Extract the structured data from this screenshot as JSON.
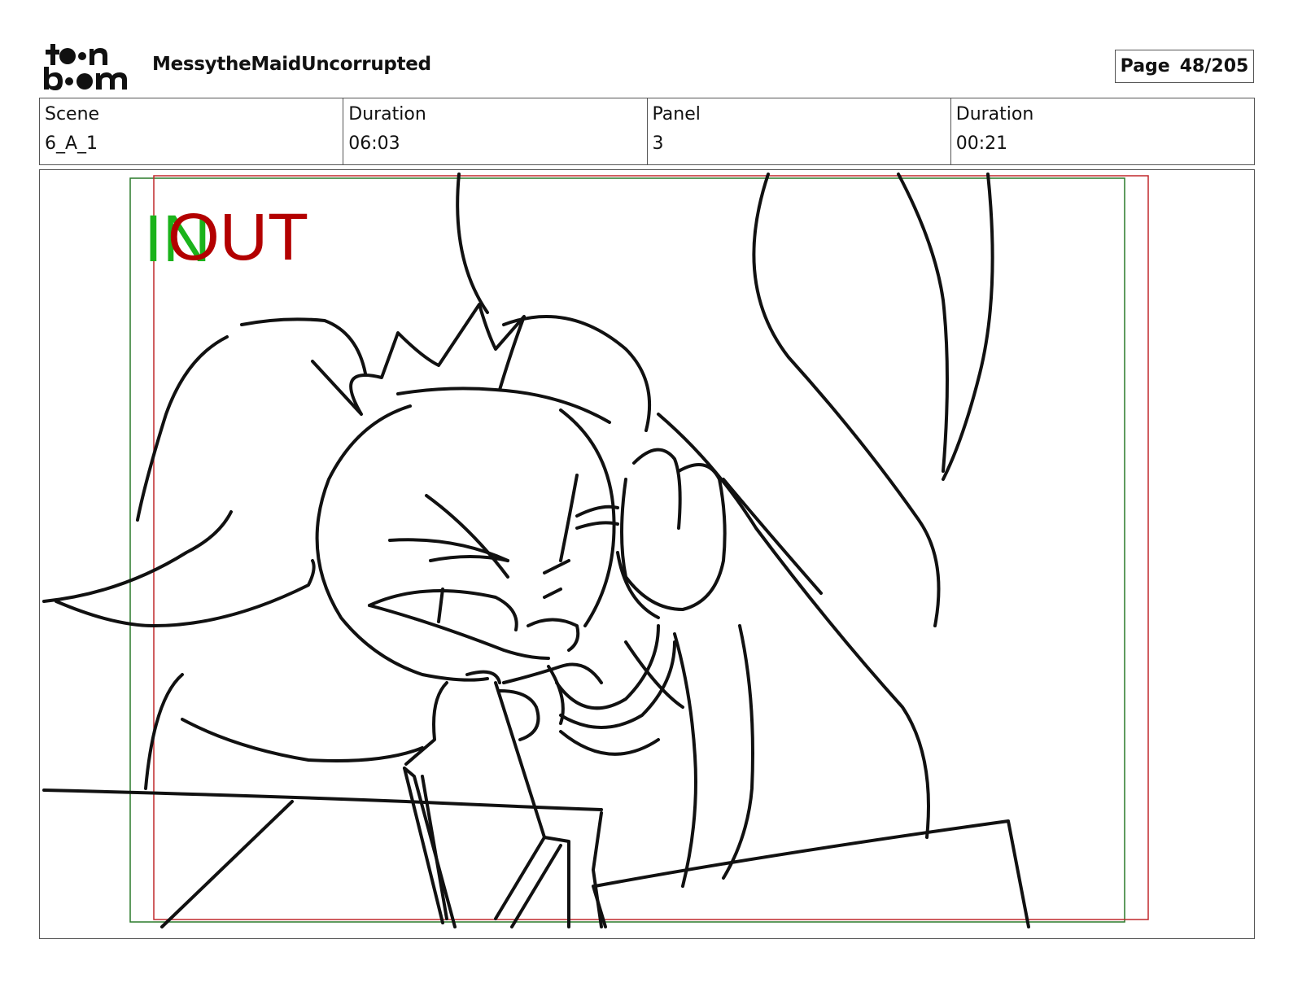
{
  "header": {
    "logo_lines": [
      "toon",
      "boom"
    ],
    "project_title": "MessytheMaidUncorrupted",
    "page_label": "Page",
    "page_number": "48/205"
  },
  "info_table": [
    {
      "label": "Scene",
      "value": "6_A_1"
    },
    {
      "label": "Duration",
      "value": "06:03"
    },
    {
      "label": "Panel",
      "value": "3"
    },
    {
      "label": "Duration",
      "value": "00:21"
    }
  ],
  "panel": {
    "in_marker": "IN",
    "out_marker": "OUT",
    "colors": {
      "in": "#1bb31b",
      "out": "#b30000",
      "frame_green": "#2a7a2a",
      "frame_red": "#c0282c"
    }
  }
}
